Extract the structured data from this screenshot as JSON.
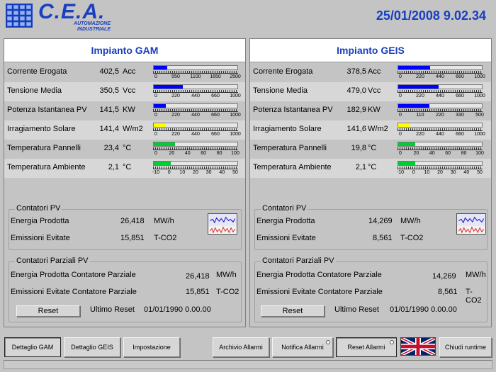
{
  "header": {
    "logo_text": "C.E.A.",
    "logo_sub1": "AUTOMAZIONE",
    "logo_sub2": "INDUSTRIALE",
    "datetime": "25/01/2008 9.02.34"
  },
  "colors": {
    "accent": "#1a3fbf",
    "bar_blue": "#0000ff",
    "bar_yellow": "#ffff00",
    "bar_green": "#00cc33"
  },
  "icons": [
    "logo-solar-panel-icon",
    "panel-decoration-icon",
    "trend-chart-icon",
    "uk-flag-icon"
  ],
  "plants": [
    {
      "title": "Impianto GAM",
      "measures": [
        {
          "label": "Corrente Erogata",
          "value": "402,5",
          "unit": "Acc",
          "ticks": [
            "0",
            "550",
            "1100",
            "1650",
            "2500"
          ],
          "fraction": 0.16,
          "color": "#0000ff"
        },
        {
          "label": "Tensione Media",
          "value": "350,5",
          "unit": "Vcc",
          "ticks": [
            "0",
            "220",
            "440",
            "660",
            "1000"
          ],
          "fraction": 0.35,
          "color": "#0000ff"
        },
        {
          "label": "Potenza Istantanea PV",
          "value": "141,5",
          "unit": "KW",
          "ticks": [
            "0",
            "220",
            "440",
            "660",
            "1000"
          ],
          "fraction": 0.14,
          "color": "#0000ff"
        },
        {
          "label": "Irragiamento Solare",
          "value": "141,4",
          "unit": "W/m2",
          "ticks": [
            "0",
            "220",
            "440",
            "660",
            "1000"
          ],
          "fraction": 0.14,
          "color": "#ffff00"
        },
        {
          "label": "Temperatura Pannelli",
          "value": "23,4",
          "unit": "°C",
          "ticks": [
            "0",
            "20",
            "40",
            "60",
            "80",
            "100"
          ],
          "fraction": 0.25,
          "color": "#00cc33"
        },
        {
          "label": "Temperatura Ambiente",
          "value": "2,1",
          "unit": "°C",
          "ticks": [
            "-10",
            "0",
            "10",
            "20",
            "30",
            "40",
            "50"
          ],
          "fraction": 0.2,
          "color": "#00cc33"
        }
      ],
      "contatori": {
        "title": "Contatori PV",
        "energia_label": "Energia Prodotta",
        "energia_value": "26,418",
        "energia_unit": "MW/h",
        "emissioni_label": "Emissioni Evitate",
        "emissioni_value": "15,851",
        "emissioni_unit": "T-CO2"
      },
      "parziali": {
        "title": "Contatori Parziali PV",
        "energia_label": "Energia Prodotta Contatore Parziale",
        "energia_value": "26,418",
        "energia_unit": "MW/h",
        "emissioni_label": "Emissioni Evitate Contatore Parziale",
        "emissioni_value": "15,851",
        "emissioni_unit": "T-CO2",
        "reset_label": "Reset",
        "ultimo_reset_label": "Ultimo Reset",
        "ultimo_reset_value": "01/01/1990 0.00.00"
      }
    },
    {
      "title": "Impianto GEIS",
      "measures": [
        {
          "label": "Corrente Erogata",
          "value": "378,5",
          "unit": "Acc",
          "ticks": [
            "0",
            "220",
            "440",
            "660",
            "1000"
          ],
          "fraction": 0.38,
          "color": "#0000ff"
        },
        {
          "label": "Tensione Media",
          "value": "479,0",
          "unit": "Vcc",
          "ticks": [
            "0",
            "220",
            "440",
            "660",
            "1000"
          ],
          "fraction": 0.48,
          "color": "#0000ff"
        },
        {
          "label": "Potenza Istantanea PV",
          "value": "182,9",
          "unit": "KW",
          "ticks": [
            "0",
            "110",
            "220",
            "330",
            "500"
          ],
          "fraction": 0.37,
          "color": "#0000ff"
        },
        {
          "label": "Irragiamento Solare",
          "value": "141,6",
          "unit": "W/m2",
          "ticks": [
            "0",
            "220",
            "440",
            "660",
            "1000"
          ],
          "fraction": 0.14,
          "color": "#ffff00"
        },
        {
          "label": "Temperatura Pannelli",
          "value": "19,8",
          "unit": "°C",
          "ticks": [
            "0",
            "20",
            "40",
            "60",
            "80",
            "100"
          ],
          "fraction": 0.2,
          "color": "#00cc33"
        },
        {
          "label": "Temperatura Ambiente",
          "value": "2,1",
          "unit": "°C",
          "ticks": [
            "-10",
            "0",
            "10",
            "20",
            "30",
            "40",
            "50"
          ],
          "fraction": 0.2,
          "color": "#00cc33"
        }
      ],
      "contatori": {
        "title": "Contatori PV",
        "energia_label": "Energia Prodotta",
        "energia_value": "14,269",
        "energia_unit": "MW/h",
        "emissioni_label": "Emissioni Evitate",
        "emissioni_value": "8,561",
        "emissioni_unit": "T-CO2"
      },
      "parziali": {
        "title": "Contatori Parziali PV",
        "energia_label": "Energia Prodotta Contatore Parziale",
        "energia_value": "14,269",
        "energia_unit": "MW/h",
        "emissioni_label": "Emissioni Evitate Contatore Parziale",
        "emissioni_value": "8,561",
        "emissioni_unit": "T-CO2",
        "reset_label": "Reset",
        "ultimo_reset_label": "Ultimo Reset",
        "ultimo_reset_value": "01/01/1990 0.00.00"
      }
    }
  ],
  "nav": {
    "dettaglio_gam": "Dettaglio GAM",
    "dettaglio_geis": "Dettaglio GEIS",
    "impostazione": "Impostazione",
    "archivio_allarmi": "Archivio Allarmi",
    "notifica_allarmi": "Notifica Allarmi",
    "reset_allarmi": "Reset Allarmi",
    "chiudi_runtime": "Chiudi runtime"
  }
}
